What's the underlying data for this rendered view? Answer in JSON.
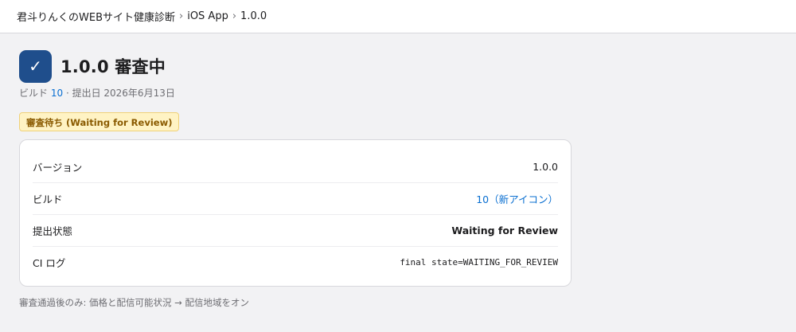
{
  "breadcrumb": {
    "team": "君斗りんくのWEBサイト健康診断",
    "app": "iOS App",
    "version": "1.0.0",
    "separator": "›"
  },
  "header": {
    "icon_glyph": "✓",
    "icon_color": "#1f4e8c",
    "title": "1.0.0 審査中",
    "meta_build_prefix": "ビルド",
    "meta_build_number": "10",
    "meta_submitted": "· 提出日 2026年6月13日"
  },
  "status_badge": {
    "label": "審査待ち (Waiting for Review)",
    "color": "#8a5a00",
    "background": "#fff3c4"
  },
  "details": [
    {
      "label": "バージョン",
      "value": "1.0.0"
    },
    {
      "label": "ビルド",
      "value": "10（新アイコン）"
    },
    {
      "label": "提出状態",
      "value": "Waiting for Review"
    },
    {
      "label": "CI ログ",
      "value": "final state=WAITING_FOR_REVIEW"
    }
  ],
  "footnote": "審査通過後のみ: 価格と配信可能状況 → 配信地域をオン",
  "colors": {
    "link": "#0a6fd1",
    "background": "#f2f2f4"
  }
}
